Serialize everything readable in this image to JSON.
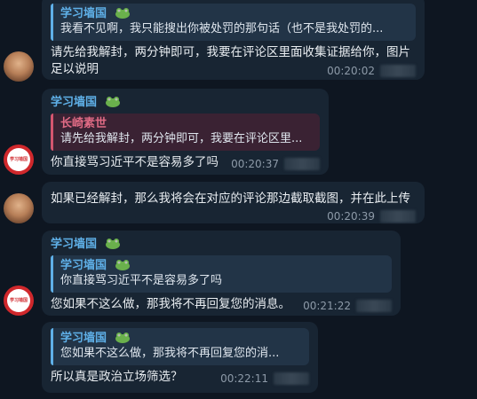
{
  "messages": [
    {
      "reply": {
        "name": "",
        "text": "我看不见啊，我只能搜出你被处罚的那句话（也不是我处罚的..."
      },
      "text_lines": [
        "请先给我解封，两分钟即可，我要在评论区里面收集证据给你，图片",
        "足以说明"
      ],
      "time": "00:20:02"
    },
    {
      "sender": "学习墙国",
      "reply": {
        "name": "长崎素世",
        "text": "请先给我解封，两分钟即可，我要在评论区里..."
      },
      "text": "你直接骂习近平不是容易多了吗",
      "time": "00:20:37"
    },
    {
      "text": "如果已经解封，那么我将会在对应的评论那边截取截图，并在此上传",
      "time": "00:20:39"
    },
    {
      "sender": "学习墙国",
      "reply": {
        "name": "学习墙国",
        "text": "你直接骂习近平不是容易多了吗"
      },
      "text": "您如果不这么做，那我将不再回复您的消息。",
      "time": "00:21:22"
    },
    {
      "reply": {
        "name": "学习墙国",
        "text": "您如果不这么做，那我将不再回复您的消..."
      },
      "text": "所以真是政治立场筛选？",
      "time": "00:22:11"
    }
  ],
  "avatars": {
    "badge_text": "学习墙国"
  },
  "colors": {
    "background": "#0e1621",
    "bubble": "#182533",
    "accent": "#5fb0e8",
    "reply_red": "#e06b85"
  }
}
